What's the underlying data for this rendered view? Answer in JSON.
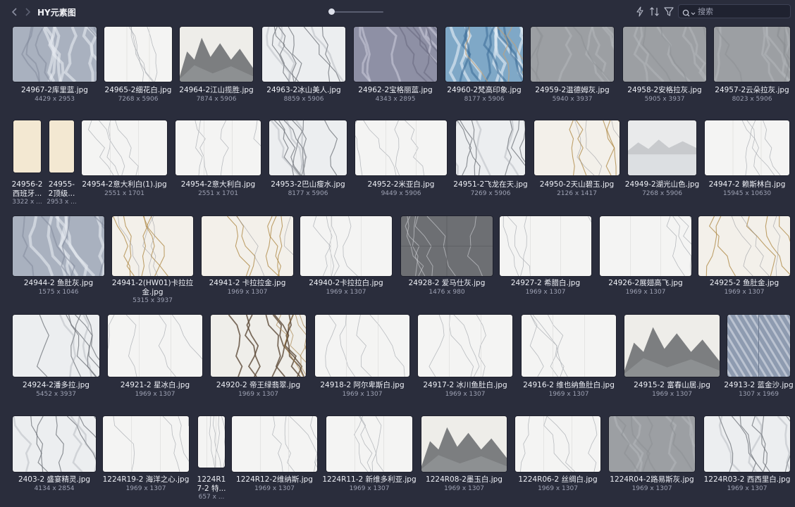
{
  "toolbar": {
    "folder_title": "HY元素图",
    "search_placeholder": "搜索",
    "icons": [
      "back-icon",
      "forward-icon",
      "lightning-icon",
      "sort-icon",
      "filter-icon",
      "search-icon"
    ]
  },
  "items": [
    {
      "name": "24967-2库里蓝.jpg",
      "dims": "4429 x 2953",
      "style": "bluegray"
    },
    {
      "name": "24965-2细花白.jpg",
      "dims": "7268 x 5906",
      "style": "white"
    },
    {
      "name": "24964-2江山揽胜.jpg",
      "dims": "7874 x 5906",
      "style": "landscape"
    },
    {
      "name": "24963-2冰山美人.jpg",
      "dims": "8859 x 5906",
      "style": "grayvein"
    },
    {
      "name": "24962-2宝格丽蓝.jpg",
      "dims": "4343 x 2895",
      "style": "purplegray"
    },
    {
      "name": "24960-2梵高印象.jpg",
      "dims": "8177 x 5906",
      "style": "blue"
    },
    {
      "name": "24959-2温德姆灰.jpg",
      "dims": "5940 x 3937",
      "style": "gray"
    },
    {
      "name": "24958-2安格拉灰.jpg",
      "dims": "5905 x 3937",
      "style": "gray"
    },
    {
      "name": "24957-2云朵拉灰.jpg",
      "dims": "8023 x 5906",
      "style": "gray"
    },
    {
      "name": "24956-2西班牙...",
      "dims": "3322 x ...",
      "style": "cream"
    },
    {
      "name": "24955-2顶级...",
      "dims": "2953 x ...",
      "style": "cream"
    },
    {
      "name": "24954-2意大利白(1).jpg",
      "dims": "2551 x 1701",
      "style": "white"
    },
    {
      "name": "24954-2意大利白.jpg",
      "dims": "2551 x 1701",
      "style": "white"
    },
    {
      "name": "24953-2巴山瘦水.jpg",
      "dims": "8177 x 5906",
      "style": "grayvein"
    },
    {
      "name": "24952-2米亚白.jpg",
      "dims": "9449 x 5906",
      "style": "white"
    },
    {
      "name": "24951-2飞龙在天.jpg",
      "dims": "7269 x 5906",
      "style": "grayvein"
    },
    {
      "name": "24950-2天山碧玉.jpg",
      "dims": "2126 x 1417",
      "style": "goldvein"
    },
    {
      "name": "24949-2湖光山色.jpg",
      "dims": "7268 x 5906",
      "style": "mist"
    },
    {
      "name": "24947-2 赖斯林白.jpg",
      "dims": "15945 x 10630",
      "style": "white"
    },
    {
      "name": "24944-2 鱼肚灰.jpg",
      "dims": "1575 x 1046",
      "style": "bluegray"
    },
    {
      "name": "24941-2(HW01)卡拉拉金.jpg",
      "dims": "5315 x 3937",
      "style": "goldvein"
    },
    {
      "name": "24941-2 卡拉拉金.jpg",
      "dims": "1969 x 1307",
      "style": "goldvein"
    },
    {
      "name": "24940-2卡拉拉白.jpg",
      "dims": "1969 x 1307",
      "style": "white"
    },
    {
      "name": "24928-2 爱马仕灰.jpg",
      "dims": "1476 x 980",
      "style": "darkgray"
    },
    {
      "name": "24927-2 希腊白.jpg",
      "dims": "1969 x 1307",
      "style": "white"
    },
    {
      "name": "24926-2展翅高飞.jpg",
      "dims": "1969 x 1307",
      "style": "white"
    },
    {
      "name": "24925-2 鱼肚金.jpg",
      "dims": "1969 x 1307",
      "style": "goldvein"
    },
    {
      "name": "24924-2潘多拉.jpg",
      "dims": "5452 x 3937",
      "style": "grayvein"
    },
    {
      "name": "24921-2 星冰白.jpg",
      "dims": "1969 x 1307",
      "style": "white"
    },
    {
      "name": "24920-2 帝王绿翡翠.jpg",
      "dims": "1969 x 1307",
      "style": "brownvein"
    },
    {
      "name": "24918-2 阿尔卑斯白.jpg",
      "dims": "1969 x 1307",
      "style": "white"
    },
    {
      "name": "24917-2 冰川鱼肚白.jpg",
      "dims": "1969 x 1307",
      "style": "white"
    },
    {
      "name": "24916-2 维也纳鱼肚白.jpg",
      "dims": "1969 x 1307",
      "style": "white"
    },
    {
      "name": "24915-2 富春山居.jpg",
      "dims": "1969 x 1307",
      "style": "landscape"
    },
    {
      "name": "24913-2 蓝金沙.jpg",
      "dims": "1307 x 1969",
      "style": "herringbone"
    },
    {
      "name": "2403-2 盛宴精灵.jpg",
      "dims": "4134 x 2854",
      "style": "grayvein"
    },
    {
      "name": "1224R19-2 海洋之心.jpg",
      "dims": "1969 x 1307",
      "style": "white"
    },
    {
      "name": "1224R17-2 特...",
      "dims": "657 x ...",
      "style": "white"
    },
    {
      "name": "1224R12-2维纳斯.jpg",
      "dims": "1969 x 1307",
      "style": "white"
    },
    {
      "name": "1224R11-2 新维多利亚.jpg",
      "dims": "1969 x 1307",
      "style": "white"
    },
    {
      "name": "1224R08-2墨玉白.jpg",
      "dims": "1969 x 1307",
      "style": "landscape"
    },
    {
      "name": "1224R06-2 丝绸白.jpg",
      "dims": "1969 x 1307",
      "style": "white"
    },
    {
      "name": "1224R04-2路易斯灰.jpg",
      "dims": "1969 x 1307",
      "style": "gray"
    },
    {
      "name": "1224R03-2 西西里白.jpg",
      "dims": "1969 x 1307",
      "style": "grayvein"
    }
  ]
}
